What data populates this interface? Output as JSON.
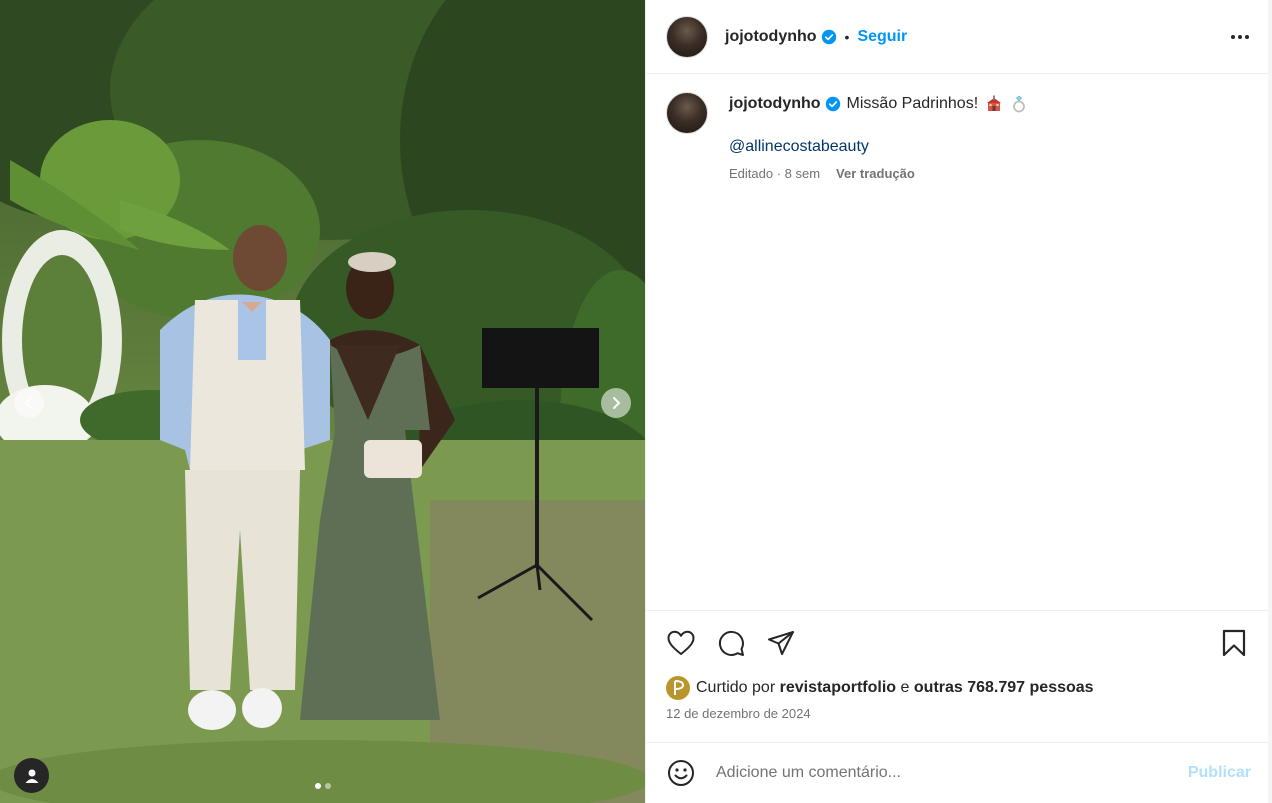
{
  "post": {
    "username": "jojotodynho",
    "verified": true,
    "separator": "•",
    "follow_label": "Seguir",
    "more_icon": "more-horizontal-icon"
  },
  "caption": {
    "username": "jojotodynho",
    "text": "Missão Padrinhos!",
    "emojis": [
      "church-emoji",
      "ring-emoji"
    ],
    "mention": "@allinecostabeauty",
    "edited_label": "Editado · 8 sem",
    "translate_label": "Ver tradução"
  },
  "actions": {
    "icons": [
      "heart-icon",
      "comment-icon",
      "share-icon",
      "bookmark-icon"
    ]
  },
  "likes": {
    "prefix": "Curtido por",
    "user": "revistaportfolio",
    "connector": "e",
    "others": "outras 768.797 pessoas"
  },
  "date": "12 de dezembro de 2024",
  "comment": {
    "placeholder": "Adicione um comentário...",
    "publish_label": "Publicar"
  },
  "carousel": {
    "slide_count": 2,
    "active_index": 0
  },
  "colors": {
    "accent": "#0095f6",
    "mention": "#00376b",
    "muted": "#737373",
    "publish_disabled": "#b2dffc"
  }
}
